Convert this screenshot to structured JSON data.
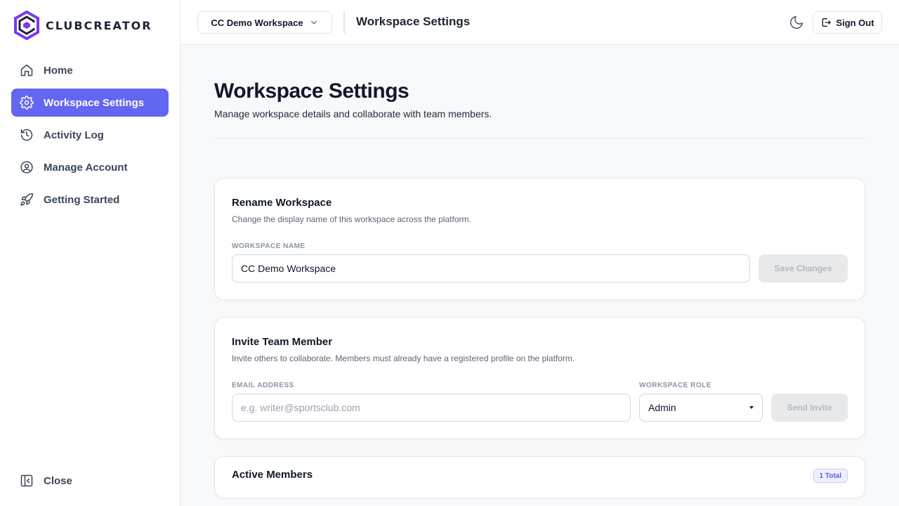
{
  "app": {
    "brand": "CLUBCREATOR",
    "accent_color": "#6366f1"
  },
  "sidebar": {
    "items": [
      {
        "label": "Home",
        "icon": "home-icon",
        "active": false
      },
      {
        "label": "Workspace Settings",
        "icon": "gear-icon",
        "active": true
      },
      {
        "label": "Activity Log",
        "icon": "history-icon",
        "active": false
      },
      {
        "label": "Manage Account",
        "icon": "user-circle-icon",
        "active": false
      },
      {
        "label": "Getting Started",
        "icon": "rocket-icon",
        "active": false
      }
    ],
    "close_label": "Close"
  },
  "topbar": {
    "workspace": "CC Demo Workspace",
    "title": "Workspace Settings",
    "signout_label": "Sign Out"
  },
  "page": {
    "title": "Workspace Settings",
    "subtitle": "Manage workspace details and collaborate with team members."
  },
  "rename": {
    "title": "Rename Workspace",
    "description": "Change the display name of this workspace across the platform.",
    "field_label": "WORKSPACE NAME",
    "value": "CC Demo Workspace",
    "button": "Save Changes"
  },
  "invite": {
    "title": "Invite Team Member",
    "description": "Invite others to collaborate. Members must already have a registered profile on the platform.",
    "email_label": "EMAIL ADDRESS",
    "email_placeholder": "e.g. writer@sportsclub.com",
    "role_label": "WORKSPACE ROLE",
    "role_value": "Admin",
    "button": "Send Invite"
  },
  "members": {
    "title": "Active Members",
    "count_badge": "1 Total"
  }
}
